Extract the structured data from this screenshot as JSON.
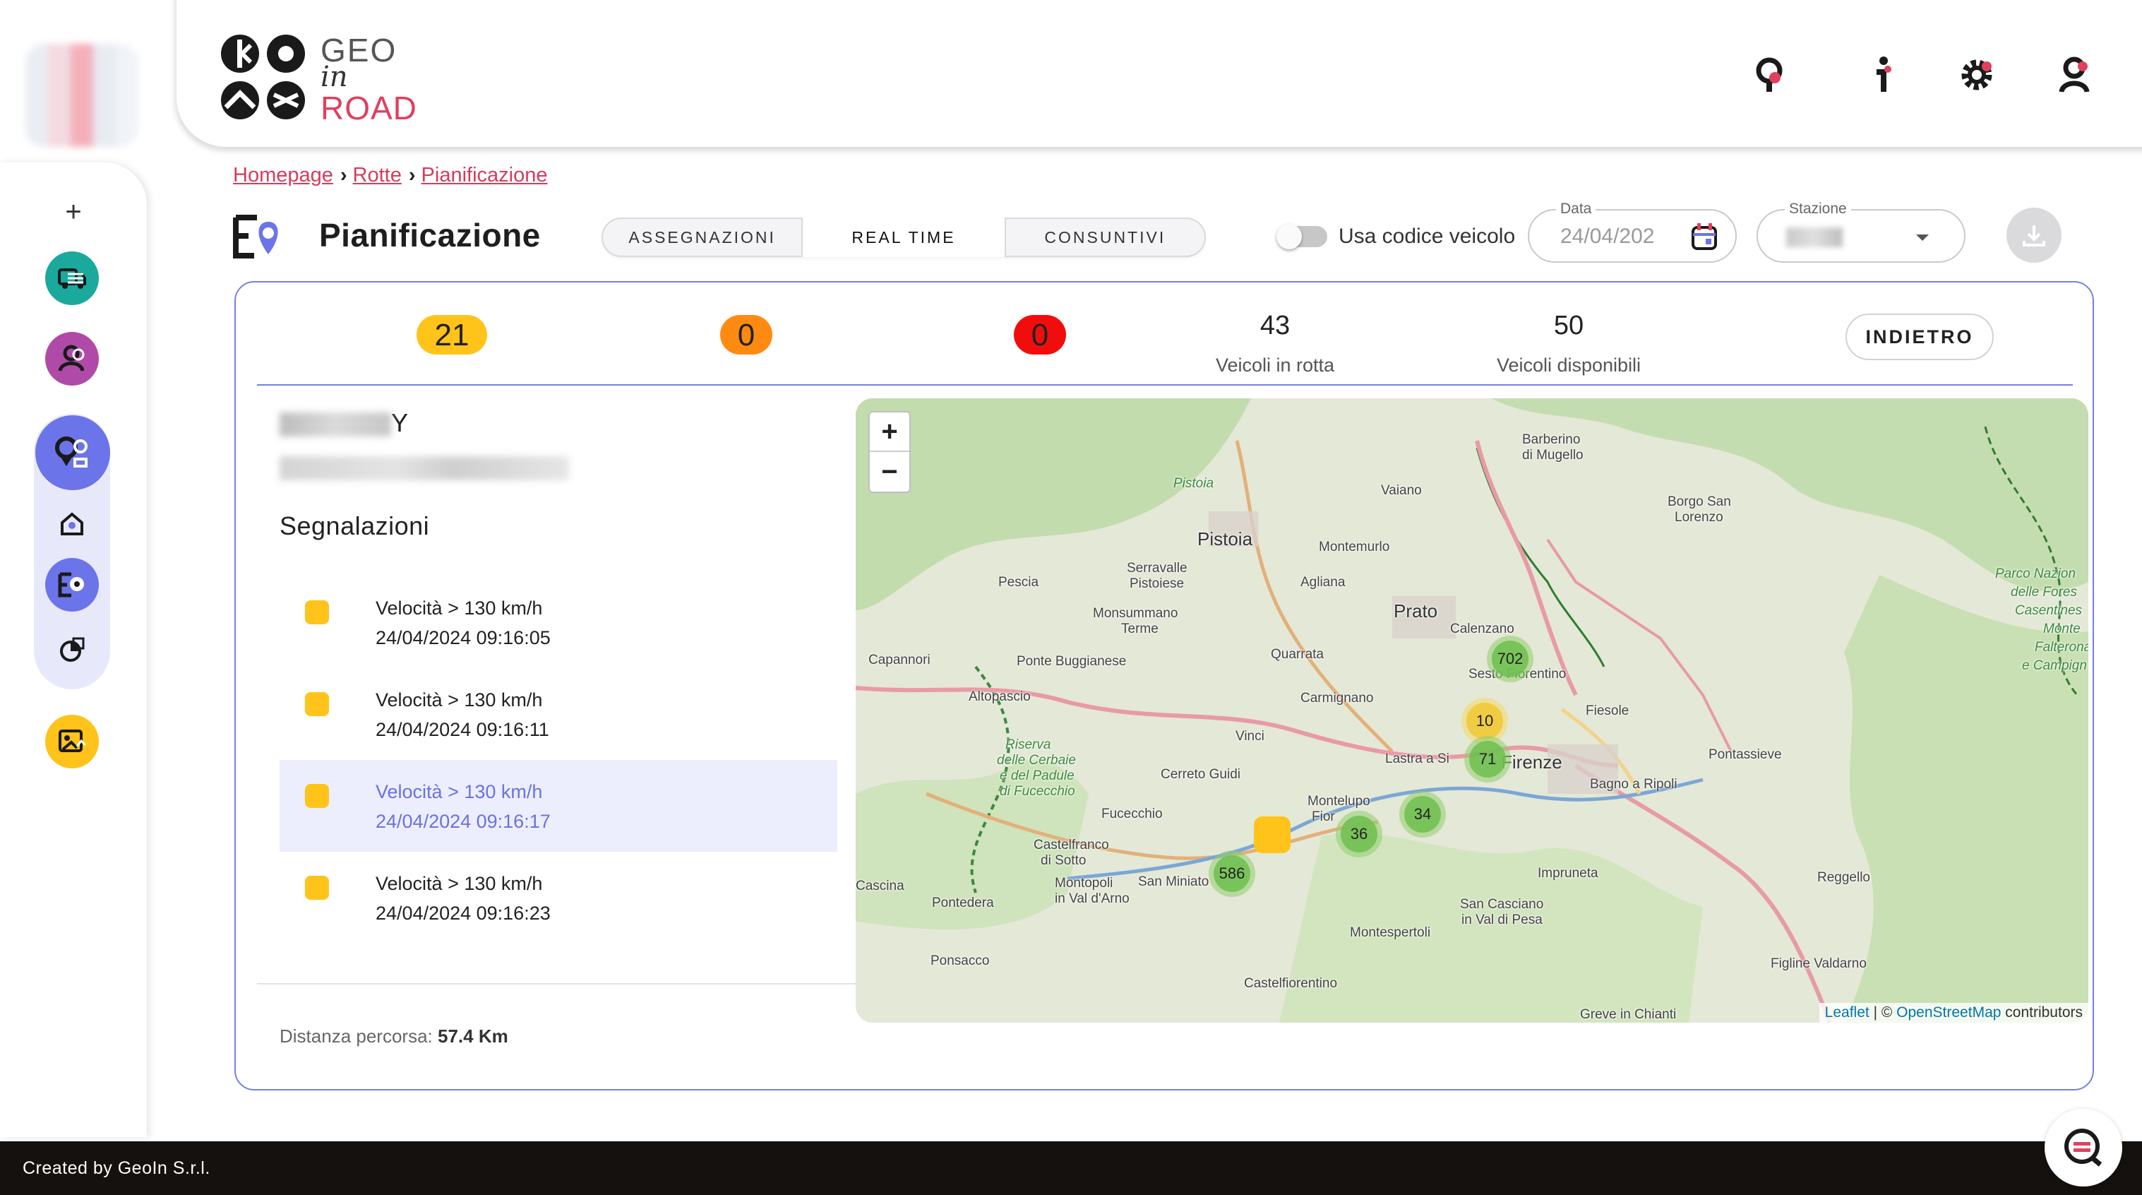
{
  "brand": {
    "geo": "GEO",
    "in": "in",
    "road": "ROAD",
    "accent": "#e0405e"
  },
  "header_icons": [
    "map-pin-icon",
    "info-icon",
    "gear-icon",
    "user-icon"
  ],
  "sidebar": {
    "plus": "+",
    "items": [
      {
        "icon": "truck-list-icon",
        "color": "#1aa99c"
      },
      {
        "icon": "users-icon",
        "color": "#b04aa8"
      },
      {
        "icon": "route-pin-icon",
        "color": "#6b74e8"
      },
      {
        "icon": "home-pin-icon",
        "color": "#6b74e8"
      },
      {
        "icon": "planning-icon",
        "color": "#6b74e8"
      },
      {
        "icon": "report-icon",
        "color": "#6b74e8"
      },
      {
        "icon": "image-chart-icon",
        "color": "#ffc31a"
      }
    ]
  },
  "breadcrumb": {
    "items": [
      "Homepage",
      "Rotte",
      "Pianificazione"
    ]
  },
  "page_title": "Pianificazione",
  "tabs": [
    {
      "label": "ASSEGNAZIONI",
      "active": false
    },
    {
      "label": "REAL TIME",
      "active": true
    },
    {
      "label": "CONSUNTIVI",
      "active": false
    }
  ],
  "toggle": {
    "label": "Usa codice veicolo",
    "on": false
  },
  "date_field": {
    "label": "Data",
    "value": "24/04/202"
  },
  "station_field": {
    "label": "Stazione"
  },
  "stats": {
    "yellow": {
      "value": "21",
      "color": "#ffc31a"
    },
    "orange": {
      "value": "0",
      "color": "#ff8a12"
    },
    "red": {
      "value": "0",
      "color": "#f20d0d"
    },
    "in_route": {
      "value": "43",
      "label": "Veicoli in rotta"
    },
    "available": {
      "value": "50",
      "label": "Veicoli disponibili"
    },
    "back_label": "INDIETRO"
  },
  "vehicle": {
    "name_suffix": "Y"
  },
  "alerts": {
    "title": "Segnalazioni",
    "items": [
      {
        "text": "Velocità > 130 km/h",
        "time": "24/04/2024 09:16:05",
        "selected": false
      },
      {
        "text": "Velocità > 130 km/h",
        "time": "24/04/2024 09:16:11",
        "selected": false
      },
      {
        "text": "Velocità > 130 km/h",
        "time": "24/04/2024 09:16:17",
        "selected": true
      },
      {
        "text": "Velocità > 130 km/h",
        "time": "24/04/2024 09:16:23",
        "selected": false
      }
    ]
  },
  "distance": {
    "label": "Distanza percorsa:",
    "value": "57.4 Km"
  },
  "map": {
    "zoom_in": "+",
    "zoom_out": "−",
    "clusters": [
      {
        "count": "702",
        "type": "green"
      },
      {
        "count": "10",
        "type": "yellow"
      },
      {
        "count": "71",
        "type": "green"
      },
      {
        "count": "34",
        "type": "green"
      },
      {
        "count": "36",
        "type": "green"
      },
      {
        "count": "586",
        "type": "green"
      }
    ],
    "places": {
      "pistoia": "Pistoia",
      "pistoia_small": "Pistoia",
      "prato": "Prato",
      "firenze": "Firenze",
      "barberino": "Barberino",
      "mugello": "di Mugello",
      "vaiano": "Vaiano",
      "borgo": "Borgo San",
      "lorenzo": "Lorenzo",
      "montemurlo": "Montemurlo",
      "agliana": "Agliana",
      "serravalle": "Serravalle",
      "pistoiese": "Pistoiese",
      "pescia": "Pescia",
      "monsummano": "Monsummano",
      "terme": "Terme",
      "calenzano": "Calenzano",
      "sesto": "Sesto Fiorentino",
      "quarrata": "Quarrata",
      "capannori": "Capannori",
      "ponte_buggianese": "Ponte Buggianese",
      "altopascio": "Altopascio",
      "carmignano": "Carmignano",
      "fiesole": "Fiesole",
      "pontassieve": "Pontassieve",
      "bagno": "Bagno a Ripoli",
      "vinci": "Vinci",
      "lastra": "Lastra a Si",
      "cerreto": "Cerreto Guidi",
      "montelupo": "Montelupo",
      "fior": "Fior",
      "fucecchio": "Fucecchio",
      "castelfranco": "Castelfranco",
      "sotto": "di Sotto",
      "montopoli": "Montopoli",
      "val_arno": "in Val d'Arno",
      "san_miniato": "San Miniato",
      "cascina": "Cascina",
      "pontedera": "Pontedera",
      "ponsacco": "Ponsacco",
      "impruneta": "Impruneta",
      "san_casciano": "San Casciano",
      "val_pesa": "in Val di Pesa",
      "montespertoli": "Montespertoli",
      "castelfiorentino": "Castelfiorentino",
      "reggello": "Reggello",
      "figline": "Figline Valdarno",
      "greve": "Greve in Chianti",
      "riserva1": "Riserva",
      "riserva2": "delle Cerbaie",
      "riserva3": "e del Padule",
      "riserva4": "di Fucecchio",
      "parco1": "Parco Nazion",
      "parco2": "delle Fores",
      "parco3": "Casentines",
      "parco4": "Monte",
      "parco5": "Falterona",
      "parco6": "e Campign"
    },
    "attribution": {
      "leaflet": "Leaflet",
      "sep": "| ©",
      "osm": "OpenStreetMap",
      "contributors": "contributors"
    }
  },
  "footer": {
    "text": "Created by GeoIn S.r.l."
  }
}
